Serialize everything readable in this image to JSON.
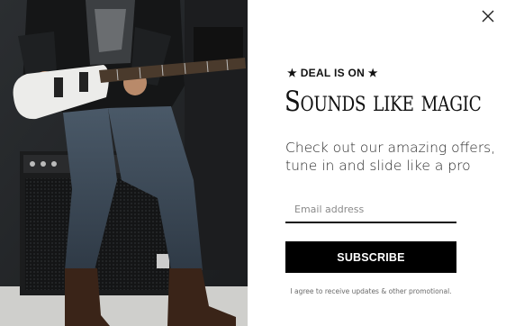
{
  "popup": {
    "eyebrow": "★ DEAL IS ON ★",
    "headline": "Sounds like magic",
    "subtext": "Check out our amazing offers, tune in and slide like a pro",
    "email_placeholder": "Email address",
    "subscribe_label": "SUBSCRIBE",
    "consent_text": "I agree to receive updates & other promotional.",
    "close_icon": "close-icon"
  },
  "colors": {
    "button": "#000000",
    "text": "#111111",
    "background": "#ffffff"
  }
}
